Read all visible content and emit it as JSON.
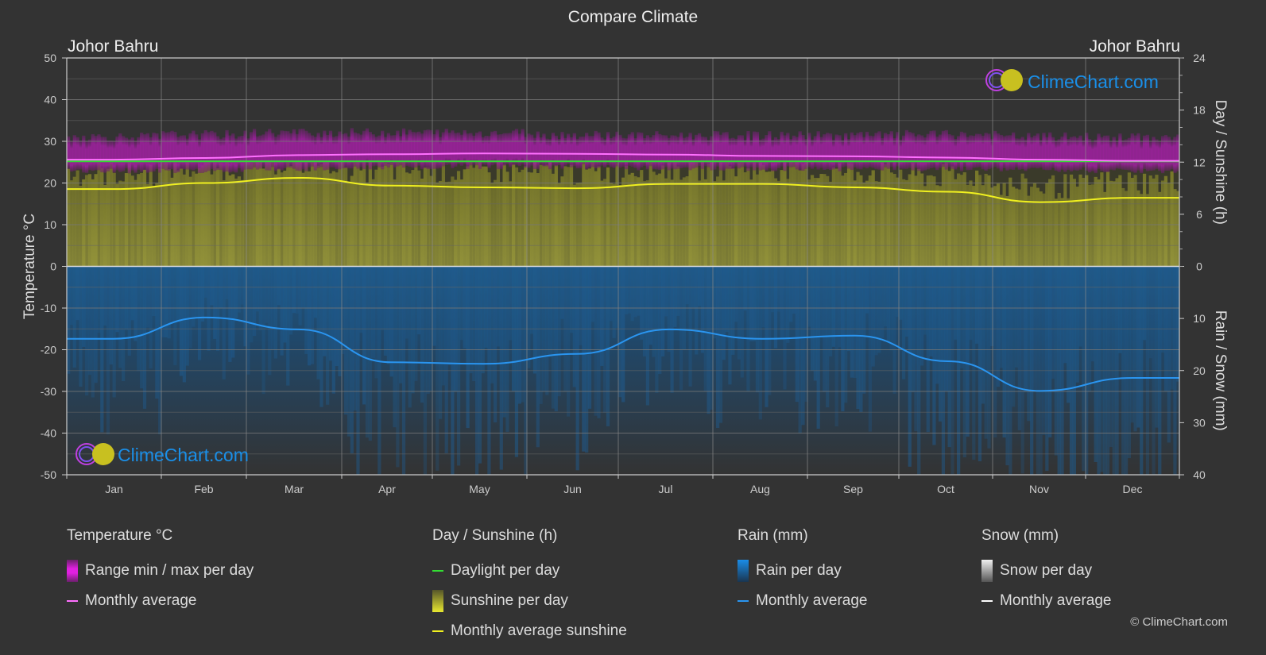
{
  "header": {
    "title": "Compare Climate",
    "location_left": "Johor Bahru",
    "location_right": "Johor Bahru"
  },
  "watermark": {
    "text": "ClimeChart.com"
  },
  "legend": {
    "groups": [
      {
        "title": "Temperature °C",
        "items": [
          {
            "label": "Range min / max per day",
            "swatch": "bar",
            "color": "#e020e0"
          },
          {
            "label": "Monthly average",
            "swatch": "line",
            "color": "#ff70ff"
          }
        ]
      },
      {
        "title": "Day / Sunshine (h)",
        "items": [
          {
            "label": "Daylight per day",
            "swatch": "line",
            "color": "#33dd33"
          },
          {
            "label": "Sunshine per day",
            "swatch": "bar",
            "color": "#e8e830"
          },
          {
            "label": "Monthly average sunshine",
            "swatch": "line",
            "color": "#f0f020"
          }
        ]
      },
      {
        "title": "Rain (mm)",
        "items": [
          {
            "label": "Rain per day",
            "swatch": "bar",
            "color": "#1a8de8"
          },
          {
            "label": "Monthly average",
            "swatch": "line",
            "color": "#2a95f0"
          }
        ]
      },
      {
        "title": "Snow (mm)",
        "items": [
          {
            "label": "Snow per day",
            "swatch": "bar",
            "color": "#f0f0f0"
          },
          {
            "label": "Monthly average",
            "swatch": "line",
            "color": "#ffffff"
          }
        ]
      }
    ]
  },
  "copyright": "© ClimeChart.com",
  "chart_data": {
    "type": "area",
    "title": "Compare Climate",
    "categories": [
      "Jan",
      "Feb",
      "Mar",
      "Apr",
      "May",
      "Jun",
      "Jul",
      "Aug",
      "Sep",
      "Oct",
      "Nov",
      "Dec"
    ],
    "left_axis": {
      "label": "Temperature °C",
      "range": [
        -50,
        50
      ],
      "ticks": [
        50,
        40,
        30,
        20,
        10,
        0,
        -10,
        -20,
        -30,
        -40,
        -50
      ]
    },
    "right_axis_top": {
      "label": "Day / Sunshine (h)",
      "range": [
        0,
        24
      ],
      "ticks": [
        24,
        18,
        12,
        6,
        0
      ]
    },
    "right_axis_bottom": {
      "label": "Rain / Snow (mm)",
      "range": [
        0,
        40
      ],
      "ticks": [
        0,
        10,
        20,
        30,
        40
      ]
    },
    "grid": true,
    "series": [
      {
        "name": "Temperature monthly average",
        "axis": "left",
        "unit": "°C",
        "color": "#ff70ff",
        "values": [
          25.6,
          26.0,
          26.7,
          26.9,
          27.1,
          27.0,
          26.8,
          26.5,
          26.4,
          26.1,
          25.6,
          25.3
        ]
      },
      {
        "name": "Temperature range min per day (approx)",
        "axis": "left",
        "unit": "°C",
        "color": "#a020a0",
        "values": [
          23.5,
          23.5,
          24.0,
          24.3,
          24.5,
          24.5,
          24.2,
          24.0,
          24.0,
          24.0,
          23.8,
          23.5
        ]
      },
      {
        "name": "Temperature range max per day (approx)",
        "axis": "left",
        "unit": "°C",
        "color": "#a020a0",
        "values": [
          30.0,
          30.5,
          31.0,
          31.0,
          31.0,
          30.5,
          30.3,
          30.3,
          30.3,
          30.5,
          30.0,
          29.8
        ]
      },
      {
        "name": "Daylight per day",
        "axis": "right_top",
        "unit": "h",
        "color": "#33dd33",
        "values": [
          12.1,
          12.1,
          12.1,
          12.1,
          12.1,
          12.1,
          12.1,
          12.1,
          12.1,
          12.1,
          12.1,
          12.1
        ]
      },
      {
        "name": "Monthly average sunshine",
        "axis": "right_top",
        "unit": "h",
        "color": "#f0f020",
        "values": [
          8.9,
          9.6,
          10.2,
          9.3,
          9.1,
          9.0,
          9.5,
          9.5,
          9.1,
          8.6,
          7.4,
          7.9
        ]
      },
      {
        "name": "Rain monthly average",
        "axis": "right_bottom",
        "unit": "mm",
        "color": "#2a95f0",
        "values": [
          13.9,
          9.8,
          12.1,
          18.4,
          18.7,
          16.8,
          12.1,
          13.9,
          13.3,
          18.2,
          23.9,
          21.4
        ]
      },
      {
        "name": "Snow monthly average",
        "axis": "right_bottom",
        "unit": "mm",
        "color": "#ffffff",
        "values": [
          0,
          0,
          0,
          0,
          0,
          0,
          0,
          0,
          0,
          0,
          0,
          0
        ]
      }
    ]
  }
}
